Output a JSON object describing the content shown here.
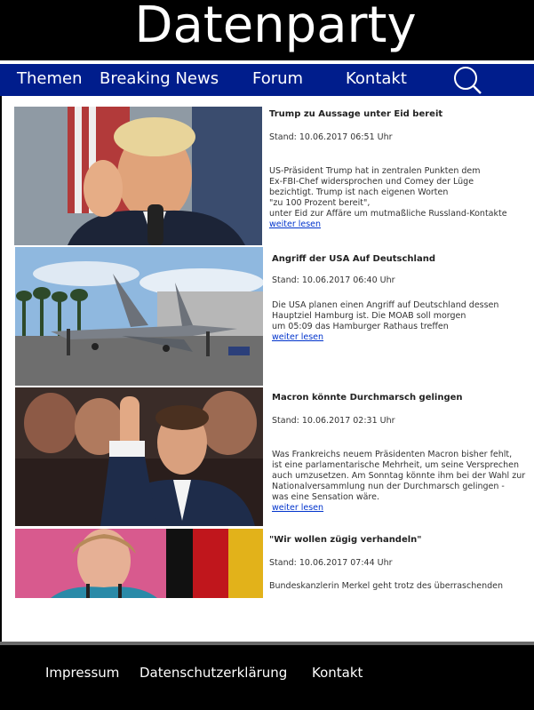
{
  "site": {
    "title": "Datenparty"
  },
  "nav": {
    "items": [
      "Themen",
      "Breaking News",
      "Forum",
      "Kontakt"
    ],
    "search_icon": "search-icon"
  },
  "articles": [
    {
      "title": "Trump zu Aussage unter Eid bereit",
      "date": "Stand: 10.06.2017 06:51 Uhr",
      "body": "US-Präsident Trump hat in zentralen Punkten dem\nEx-FBI-Chef widersprochen und Comey der Lüge\nbezichtigt. Trump ist nach eigenen Worten\n\"zu 100 Prozent bereit\",\nunter Eid zur Affäre um mutmaßliche Russland-Kontakte",
      "link": "weiter lesen"
    },
    {
      "title": "Angriff der USA Auf Deutschland",
      "date": "Stand: 10.06.2017 06:40 Uhr",
      "body": "Die USA planen einen Angriff auf Deutschland dessen\nHauptziel Hamburg ist. Die MOAB soll morgen\num 05:09 das Hamburger Rathaus treffen",
      "link": "weiter lesen"
    },
    {
      "title": "Macron könnte Durchmarsch gelingen",
      "date": "Stand: 10.06.2017 02:31 Uhr",
      "body": "Was Frankreichs neuem Präsidenten Macron bisher fehlt,\nist eine parlamentarische Mehrheit, um seine Versprechen\nauch umzusetzen. Am Sonntag könnte ihm bei der Wahl zur\nNationalversammlung nun der Durchmarsch gelingen -\nwas eine Sensation wäre.",
      "link": "weiter lesen"
    },
    {
      "title": "\"Wir wollen zügig verhandeln\"",
      "date": "Stand: 10.06.2017 07:44 Uhr",
      "body": "Bundeskanzlerin Merkel geht trotz des überraschenden",
      "link": ""
    }
  ],
  "footer": {
    "items": [
      "Impressum",
      "Datenschutzerklärung",
      "Kontakt"
    ]
  }
}
